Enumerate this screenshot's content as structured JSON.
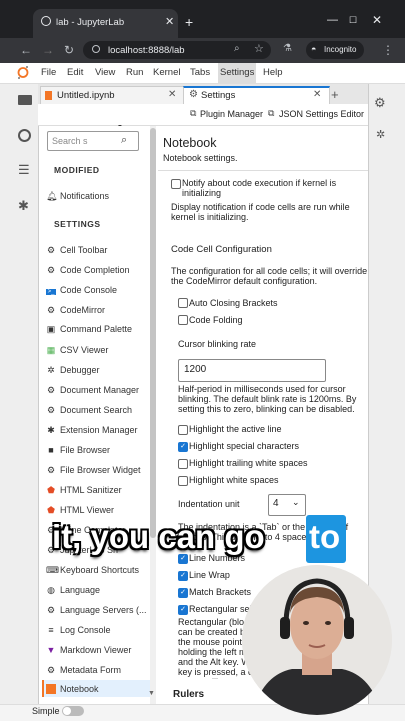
{
  "browser": {
    "tab_title": "lab - JupyterLab",
    "url": "localhost:8888/lab",
    "incognito_label": "Incognito"
  },
  "menu": [
    "File",
    "Edit",
    "View",
    "Run",
    "Kernel",
    "Tabs",
    "Settings",
    "Help"
  ],
  "doc_tabs": [
    {
      "label": "Untitled.ipynb"
    },
    {
      "label": "Settings"
    }
  ],
  "toolbar": {
    "plugin_manager": "Plugin Manager",
    "json_editor": "JSON Settings Editor"
  },
  "sidebar": {
    "search_placeholder": "Search s",
    "modified_header": "MODIFIED",
    "modified_items": [
      "Notifications"
    ],
    "settings_header": "SETTINGS",
    "items": [
      "Cell Toolbar",
      "Code Completion",
      "Code Console",
      "CodeMirror",
      "Command Palette",
      "CSV Viewer",
      "Debugger",
      "Document Manager",
      "Document Search",
      "Extension Manager",
      "File Browser",
      "File Browser Widget",
      "HTML Sanitizer",
      "HTML Viewer",
      "Inline Completer",
      "JupyterLab Sh",
      "Keyboard Shortcuts",
      "Language",
      "Language Servers (...",
      "Log Console",
      "Markdown Viewer",
      "Metadata Form",
      "Notebook"
    ]
  },
  "content": {
    "title": "Notebook",
    "subtitle": "Notebook settings.",
    "notify_label": "Notify about code execution if kernel is initializing",
    "notify_desc": "Display notification if code cells are run while kernel is initializing.",
    "code_cell_header": "Code Cell Configuration",
    "code_cell_desc": "The configuration for all code cells; it will override the CodeMirror default configuration.",
    "auto_close": "Auto Closing Brackets",
    "code_folding": "Code Folding",
    "blink_label": "Cursor blinking rate",
    "blink_value": "1200",
    "blink_desc": "Half-period in milliseconds used for cursor blinking. The default blink rate is 1200ms. By setting this to zero, blinking can be disabled.",
    "hl_active": "Highlight the active line",
    "hl_special": "Highlight special characters",
    "hl_trailing": "Highlight trailing white spaces",
    "hl_white": "Highlight white spaces",
    "indent_label": "Indentation unit",
    "indent_value": "4",
    "indent_desc": "The indentation is a `Tab` or the number of spaces. This defaults to 4 spaces.",
    "line_numbers": "Line Numbers",
    "line_wrap": "Line Wrap",
    "match_brackets": "Match Brackets",
    "rect_selection": "Rectangular selection",
    "rect_desc": "Rectangular (block) selection can be created by dragging the mouse pointer while holding the left mouse button and the Alt key. When the Alt key is pressed, a crosshair cursor will appear, indicating that the rectangular selection mode is active.",
    "rulers": "Rulers"
  },
  "status": {
    "simple_label": "Simple"
  },
  "overlay": {
    "caption": "it, you can go",
    "caption_highlight": "to"
  }
}
